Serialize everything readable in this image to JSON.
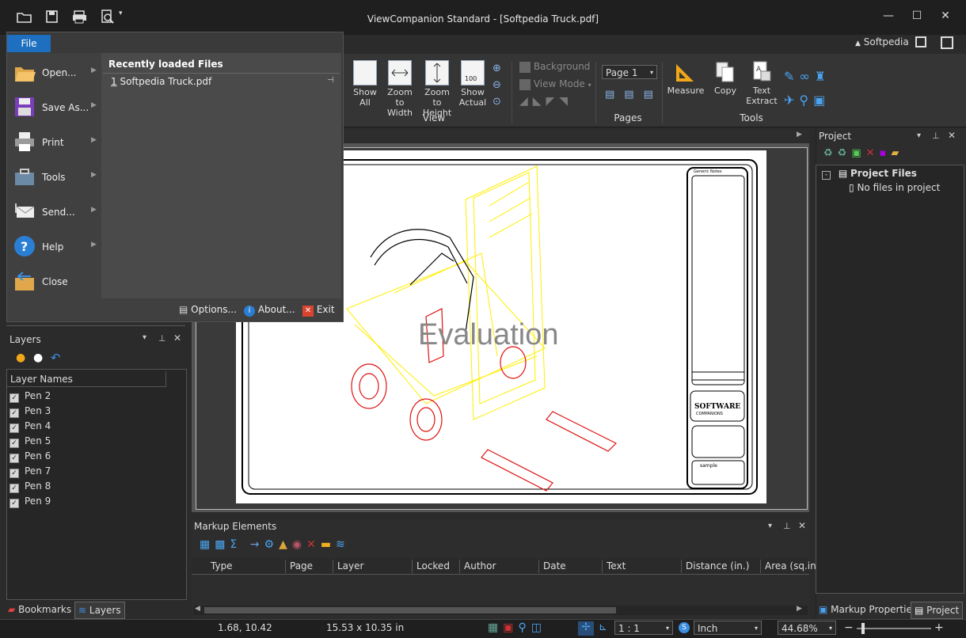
{
  "window": {
    "title": "ViewCompanion Standard - [Softpedia Truck.pdf]",
    "user_label": "Softpedia",
    "minimize": "—",
    "maximize": "☐",
    "close": "✕"
  },
  "file_menu": {
    "tab_label": "File",
    "items": [
      {
        "label": "Open...",
        "icon": "open-folder-icon"
      },
      {
        "label": "Save As...",
        "icon": "save-disk-icon"
      },
      {
        "label": "Print",
        "icon": "printer-icon"
      },
      {
        "label": "Tools",
        "icon": "toolbox-icon"
      },
      {
        "label": "Send...",
        "icon": "send-mail-icon"
      },
      {
        "label": "Help",
        "icon": "help-icon"
      },
      {
        "label": "Close",
        "icon": "close-folder-icon"
      }
    ],
    "recent_header": "Recently loaded Files",
    "recent_files": [
      {
        "index": "1",
        "name": "Softpedia Truck.pdf"
      }
    ],
    "footer": {
      "options": "Options...",
      "about": "About...",
      "exit": "Exit"
    }
  },
  "ribbon": {
    "view_partial": "v",
    "view_buttons": [
      {
        "label": "Show All"
      },
      {
        "label": "Zoom to Width"
      },
      {
        "label": "Zoom to Height"
      },
      {
        "label": "Show Actual"
      }
    ],
    "zoom_actual_badge": "100",
    "background_label": "Background",
    "view_mode_label": "View Mode",
    "view_group": "View",
    "page_select": "Page 1",
    "pages_group": "Pages",
    "measure": "Measure",
    "copy": "Copy",
    "text_extract": "Text Extract",
    "tools_group": "Tools"
  },
  "layers": {
    "title": "Layers",
    "column": "Layer Names",
    "items": [
      "Pen 2",
      "Pen 3",
      "Pen 4",
      "Pen 5",
      "Pen 6",
      "Pen 7",
      "Pen 8",
      "Pen 9"
    ],
    "checked_mark": "✓"
  },
  "left_tabs": {
    "bookmarks": "Bookmarks",
    "layers": "Layers"
  },
  "drawing": {
    "watermark": "Evaluation",
    "title_block_brand": "SOFTWARE",
    "title_block_sub": "COMPANIONS",
    "title_block_sample": "sample",
    "title_block_top": "Generic Notes"
  },
  "markup": {
    "title": "Markup Elements",
    "columns": [
      "Type",
      "Page",
      "Layer",
      "Locked",
      "Author",
      "Date",
      "Text",
      "Distance (in.)",
      "Area (sq.in.)"
    ]
  },
  "project": {
    "title": "Project",
    "root": "Project Files",
    "child": "No files in project",
    "tab_markup": "Markup Properties",
    "tab_project": "Project"
  },
  "status": {
    "coords": "1.68, 10.42",
    "size": "15.53 x 10.35 in",
    "scale": "1 : 1",
    "unit": "Inch",
    "zoom": "44.68%"
  },
  "colors": {
    "accent": "#1e6fbf",
    "drawing_yellow": "#ffee00",
    "drawing_red": "#e01010"
  }
}
